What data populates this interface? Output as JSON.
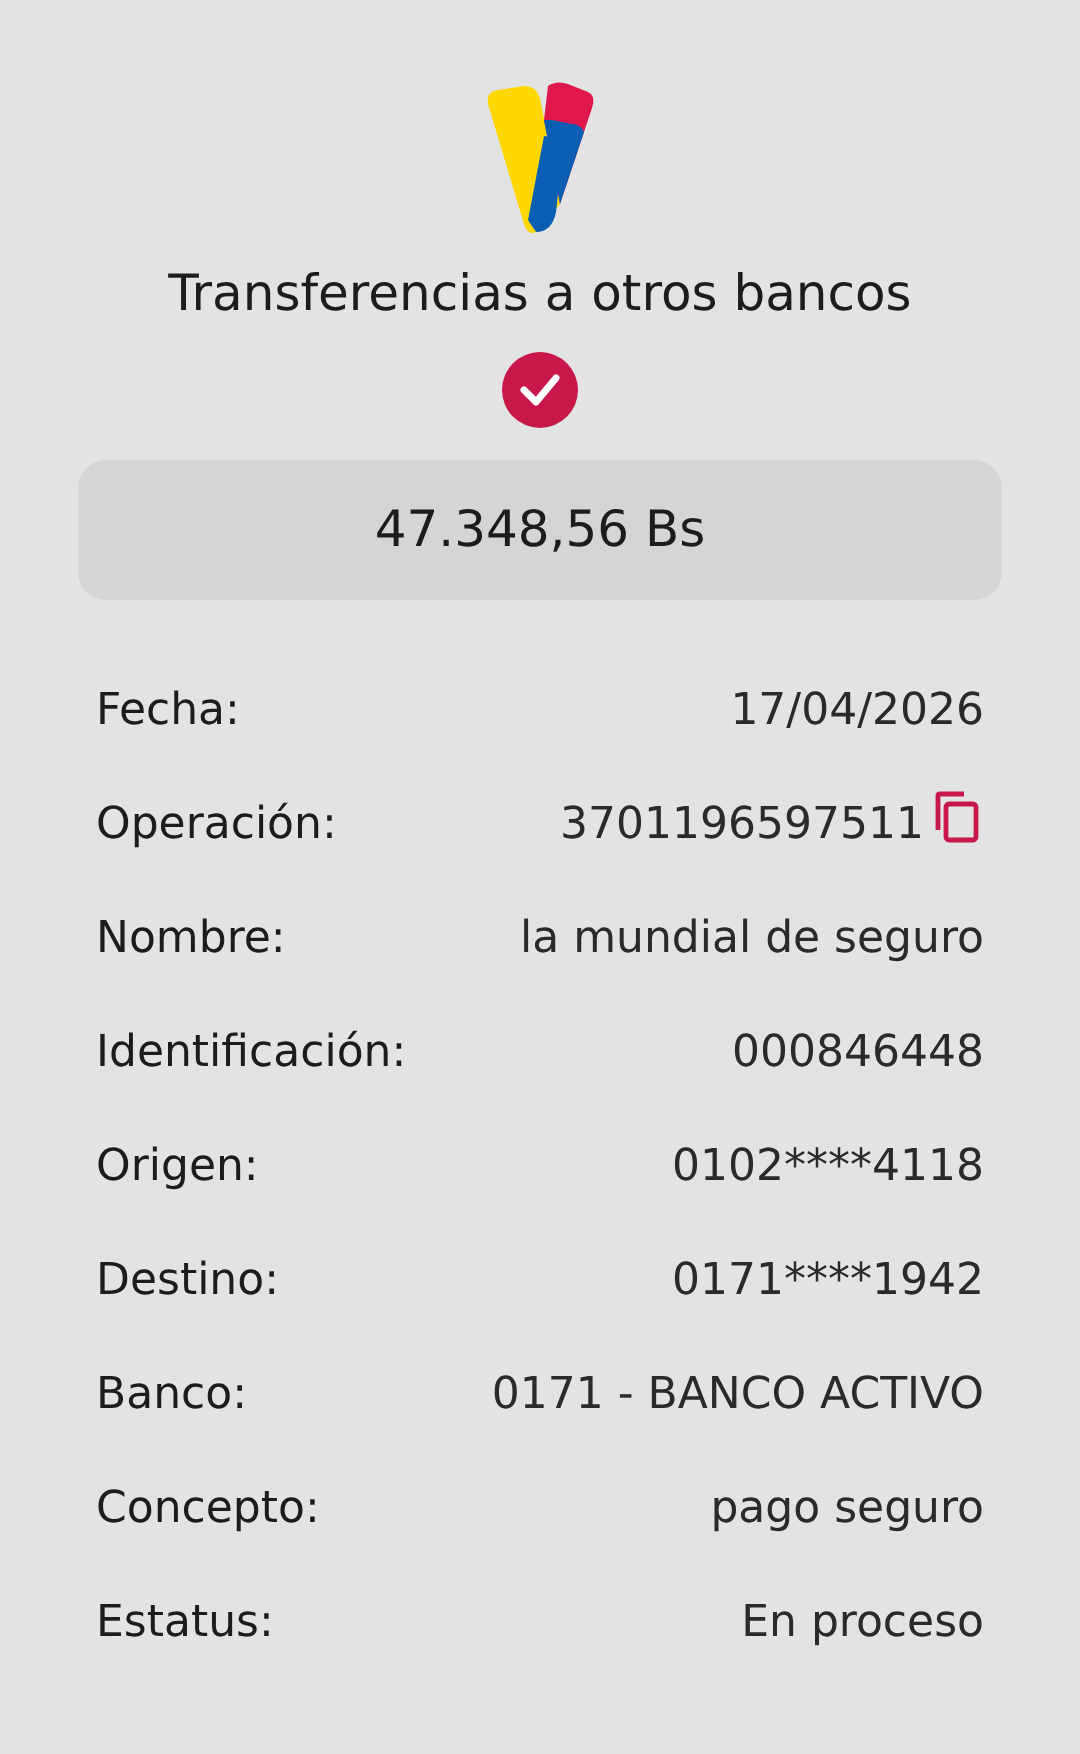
{
  "title": "Transferencias a otros bancos",
  "status_ok": true,
  "amount": "47.348,56 Bs",
  "details": [
    {
      "label": "Fecha:",
      "value": "17/04/2026",
      "copyable": false
    },
    {
      "label": "Operación:",
      "value": "3701196597511",
      "copyable": true
    },
    {
      "label": "Nombre:",
      "value": "la mundial de seguro",
      "copyable": false
    },
    {
      "label": "Identificación:",
      "value": "000846448",
      "copyable": false
    },
    {
      "label": "Origen:",
      "value": "0102****4118",
      "copyable": false
    },
    {
      "label": "Destino:",
      "value": "0171****1942",
      "copyable": false
    },
    {
      "label": "Banco:",
      "value": "0171 - BANCO ACTIVO",
      "copyable": false
    },
    {
      "label": "Concepto:",
      "value": "pago seguro",
      "copyable": false
    },
    {
      "label": "Estatus:",
      "value": "En proceso",
      "copyable": false
    }
  ]
}
